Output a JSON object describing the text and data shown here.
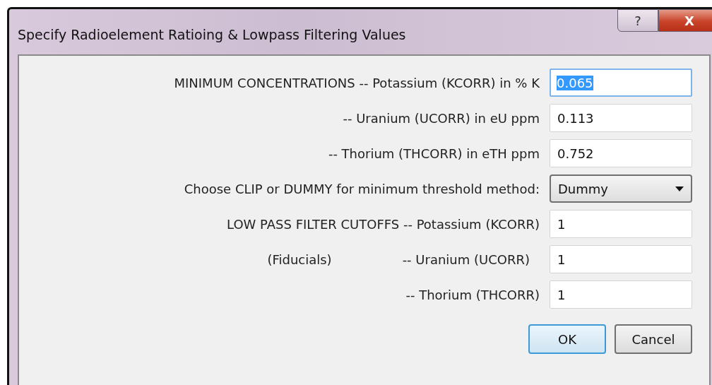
{
  "window": {
    "title": "Specify Radioelement Ratioing & Lowpass Filtering Values",
    "help_button": "?",
    "close_button": "X"
  },
  "rows": [
    {
      "kind": "field",
      "label": "MINIMUM CONCENTRATIONS -- Potassium (KCORR) in % K",
      "value": "0.065",
      "focused": true
    },
    {
      "kind": "field",
      "label": "-- Uranium (UCORR) in eU ppm",
      "value": "0.113",
      "focused": false
    },
    {
      "kind": "field",
      "label": "-- Thorium (THCORR) in eTH ppm",
      "value": "0.752",
      "focused": false
    },
    {
      "kind": "dropdown",
      "label": "Choose CLIP or DUMMY for minimum threshold method:",
      "value": "Dummy"
    },
    {
      "kind": "field",
      "label": "LOW PASS FILTER CUTOFFS -- Potassium (KCORR)",
      "value": "1",
      "focused": false
    },
    {
      "kind": "field",
      "note": "(Fiducials)",
      "label": "-- Uranium (UCORR)",
      "value": "1",
      "focused": false
    },
    {
      "kind": "field",
      "label": "-- Thorium (THCORR)",
      "value": "1",
      "focused": false
    }
  ],
  "buttons": [
    {
      "label": "OK",
      "default": true
    },
    {
      "label": "Cancel",
      "default": false
    }
  ]
}
